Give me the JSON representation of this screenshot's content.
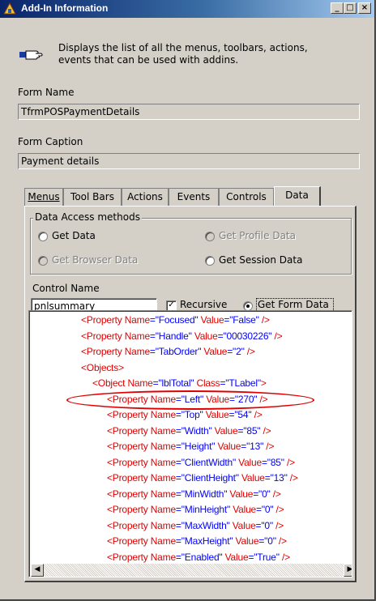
{
  "window": {
    "title": "Add-In Information",
    "minimize": "_",
    "maximize": "□",
    "close": "×"
  },
  "info": {
    "icon": "hand-pointing-icon",
    "text": "Displays the list of all the menus, toolbars, actions, events that can be used with addins."
  },
  "form_name": {
    "label": "Form Name",
    "value": "TfrmPOSPaymentDetails"
  },
  "form_caption": {
    "label": "Form Caption",
    "value": "Payment details"
  },
  "tabs": [
    {
      "label": "Menus",
      "active": false
    },
    {
      "label": "Tool Bars",
      "active": false
    },
    {
      "label": "Actions",
      "active": false
    },
    {
      "label": "Events",
      "active": false
    },
    {
      "label": "Controls",
      "active": false
    },
    {
      "label": "Data",
      "active": true
    }
  ],
  "data_access": {
    "legend": "Data Access methods",
    "options": [
      {
        "label": "Get Data",
        "enabled": true,
        "checked": false
      },
      {
        "label": "Get Profile Data",
        "enabled": false,
        "checked": false
      },
      {
        "label": "Get Browser Data",
        "enabled": false,
        "checked": false
      },
      {
        "label": "Get Session Data",
        "enabled": true,
        "checked": false
      }
    ]
  },
  "control": {
    "label": "Control Name",
    "value": "pnlsummary",
    "recursive_label": "Recursive",
    "recursive_checked": true,
    "get_form_data_label": "Get Form Data",
    "get_form_data_checked": true
  },
  "xml_lines": [
    {
      "name": "Focused",
      "value": "False"
    },
    {
      "name": "Handle",
      "value": "00030226"
    },
    {
      "name": "TabOrder",
      "value": "2"
    },
    {
      "tag": "<Objects>"
    },
    {
      "object_name": "lblTotal",
      "object_class": "TLabel"
    },
    {
      "name": "Left",
      "value": "270"
    },
    {
      "name": "Top",
      "value": "54"
    },
    {
      "name": "Width",
      "value": "85"
    },
    {
      "name": "Height",
      "value": "13"
    },
    {
      "name": "ClientWidth",
      "value": "85"
    },
    {
      "name": "ClientHeight",
      "value": "13"
    },
    {
      "name": "MinWidth",
      "value": "0"
    },
    {
      "name": "MinHeight",
      "value": "0"
    },
    {
      "name": "MaxWidth",
      "value": "0"
    },
    {
      "name": "MaxHeight",
      "value": "0"
    },
    {
      "name": "Enabled",
      "value": "True"
    }
  ],
  "colors": {
    "xml_tag": "#e00000",
    "xml_value": "#0000ff",
    "highlight": "#e00000",
    "titlebar": "#0a246a"
  }
}
